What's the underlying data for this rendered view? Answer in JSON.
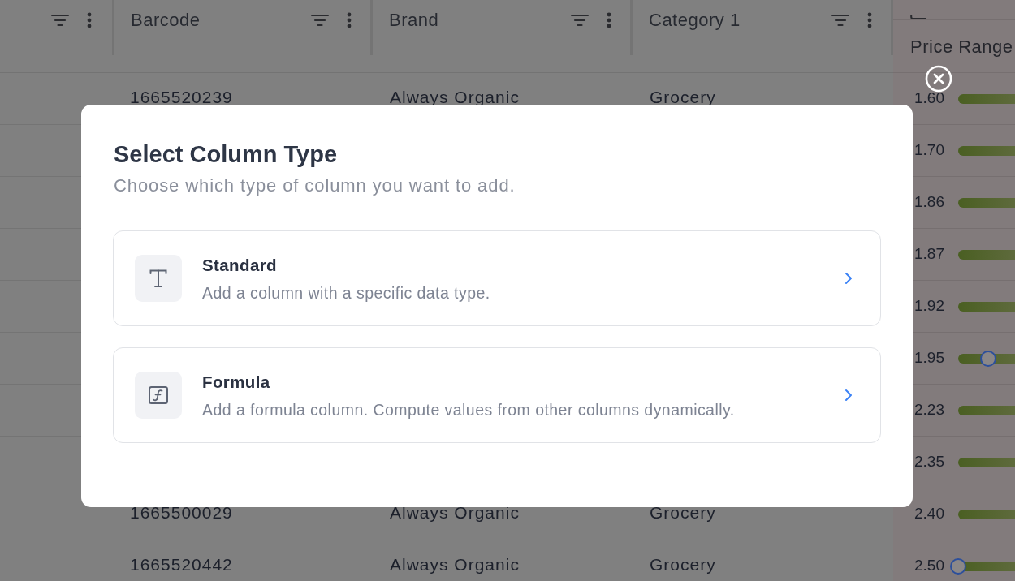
{
  "table": {
    "columns": [
      {
        "label": "Barcode"
      },
      {
        "label": "Brand"
      },
      {
        "label": "Category 1"
      }
    ],
    "price_heading": "Price Range",
    "rows": [
      {
        "cells": [
          "1665520239",
          "Always Organic",
          "Grocery"
        ],
        "price": "1.60"
      },
      {
        "price": "1.70"
      },
      {
        "price": "1.86"
      },
      {
        "price": "1.87"
      },
      {
        "price": "1.92"
      },
      {
        "price": "1.95",
        "level": 0.53
      },
      {
        "price": "2.23"
      },
      {
        "price": "2.35"
      },
      {
        "cells": [
          "1665500029",
          "Always Organic",
          "Grocery"
        ],
        "price": "2.40"
      },
      {
        "cells": [
          "1665520442",
          "Always Organic",
          "Grocery"
        ],
        "price": "2.50",
        "level": 0
      }
    ]
  },
  "dialog": {
    "title": "Select Column Type",
    "subtitle": "Choose which type of column you want to add.",
    "options": [
      {
        "kind": "standard",
        "title": "Standard",
        "description": "Add a column with a specific data type."
      },
      {
        "kind": "formula",
        "title": "Formula",
        "description": "Add a formula column. Compute values from other columns dynamically."
      }
    ]
  }
}
